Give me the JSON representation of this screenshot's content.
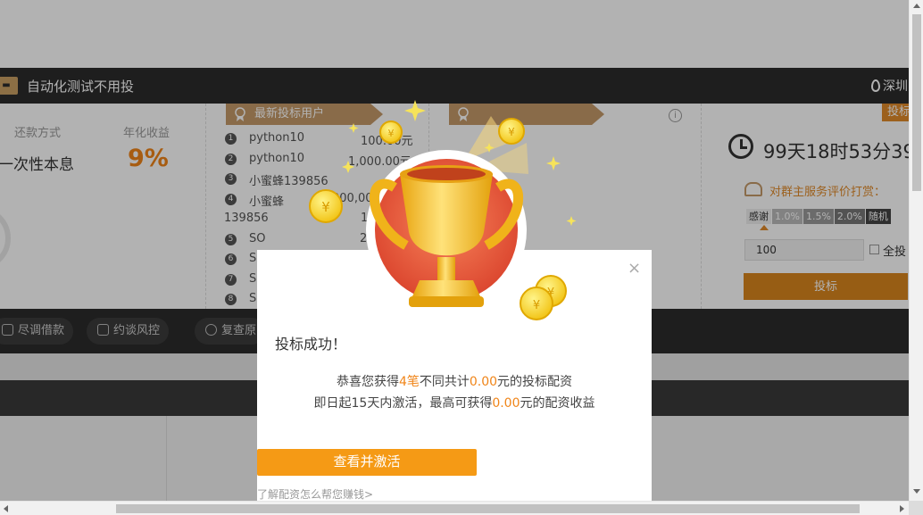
{
  "header": {
    "project_title": "自动化测试不用投",
    "location": "深圳"
  },
  "summary": {
    "repay_label": "还款方式",
    "repay_value": "一次性本息",
    "rate_label": "年化收益",
    "rate_value": "9%"
  },
  "bidders": {
    "title": "最新投标用户",
    "items": [
      {
        "num": "1",
        "name": "python10",
        "amount": "100.00元"
      },
      {
        "num": "2",
        "name": "python10",
        "amount": "1,000.00元"
      },
      {
        "num": "3",
        "name": "小蜜蜂139856",
        "amount": ""
      },
      {
        "num": "4",
        "name": "小蜜蜂",
        "amount": "000,00"
      },
      {
        "num": "",
        "name": "139856",
        "amount": "10"
      },
      {
        "num": "5",
        "name": "SO",
        "amount": "20"
      },
      {
        "num": "6",
        "name": "S",
        "amount": ""
      },
      {
        "num": "7",
        "name": "S",
        "amount": ""
      },
      {
        "num": "8",
        "name": "S",
        "amount": ""
      }
    ]
  },
  "invest": {
    "badge": "投标",
    "countdown": "99天18时53分39",
    "rate_title": "对群主服务评价打赏：",
    "tips": [
      "感谢",
      "1.0%",
      "1.5%",
      "2.0%",
      "随机"
    ],
    "amount_value": "100",
    "all_in_label": "全投",
    "submit_label": "投标"
  },
  "links": [
    "尽调借款",
    "约谈风控",
    "复查原"
  ],
  "modal": {
    "close_label": "×",
    "title": "投标成功！",
    "line1_pre": "恭喜您获得",
    "line1_count": "4笔",
    "line1_mid": "不同共计",
    "line1_amount": "0.00",
    "line1_post": "元的投标配资",
    "line2_pre": "即日起15天内激活，最高可获得",
    "line2_amount": "0.00",
    "line2_post": "元的配资收益",
    "button_label": "查看并激活",
    "link_label": "了解配资怎么帮您赚钱>"
  },
  "colors": {
    "accent": "#f08519",
    "button": "#f59a15",
    "dark_bar": "#2c2c2c",
    "tan": "#c49a69"
  }
}
